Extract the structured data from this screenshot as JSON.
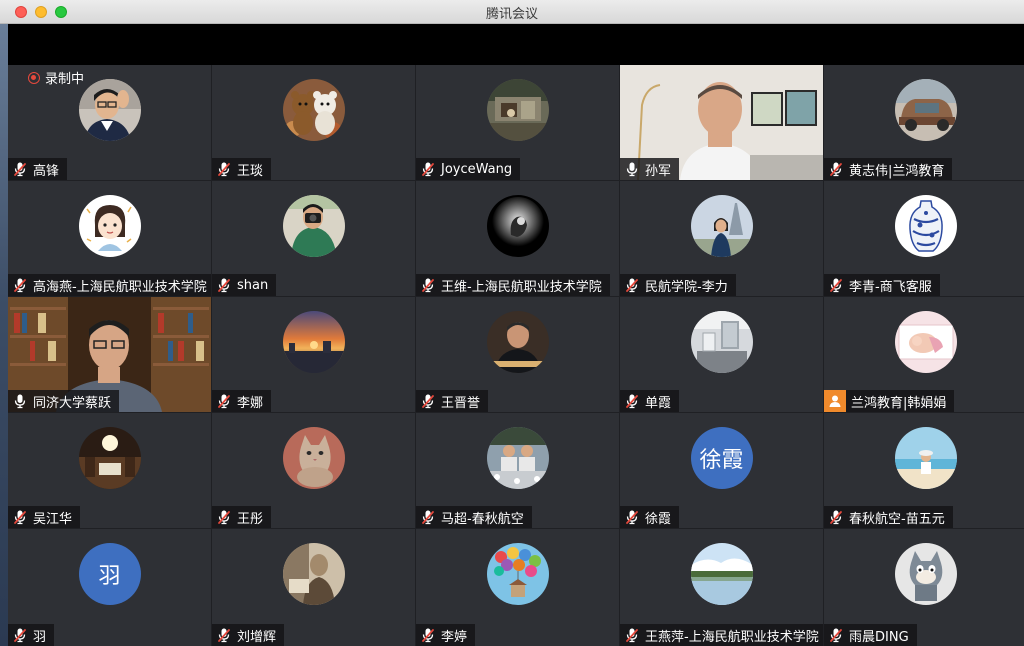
{
  "window": {
    "title": "腾讯会议"
  },
  "recording": {
    "label": "录制中"
  },
  "colors": {
    "speaking_border": "#2bd15b",
    "muted_mic": "#ffffff",
    "muted_slash": "#e5493d",
    "letter_avatar": "#3e6fc0",
    "user_badge": "#f08a2c"
  },
  "participants": [
    {
      "name": "高锋",
      "mic": "muted",
      "display": "photo-avatar",
      "avatar": "man-with-glasses"
    },
    {
      "name": "王琰",
      "mic": "muted",
      "display": "photo-avatar",
      "avatar": "teddy-bears"
    },
    {
      "name": "JoyceWang",
      "mic": "muted",
      "display": "photo-avatar",
      "avatar": "room-scene"
    },
    {
      "name": "孙军",
      "mic": "unmuted",
      "display": "video",
      "speaking": true
    },
    {
      "name": "黄志伟|兰鸿教育",
      "mic": "muted",
      "display": "photo-avatar",
      "avatar": "vintage-car"
    },
    {
      "name": "高海燕-上海民航职业技术学院",
      "mic": "muted",
      "display": "photo-avatar",
      "avatar": "cartoon-girl"
    },
    {
      "name": "shan",
      "mic": "muted",
      "display": "photo-avatar",
      "avatar": "photographer"
    },
    {
      "name": "王维-上海民航职业技术学院",
      "mic": "muted",
      "display": "photo-avatar",
      "avatar": "hand-gesture"
    },
    {
      "name": "民航学院-李力",
      "mic": "muted",
      "display": "photo-avatar",
      "avatar": "eiffel-tower"
    },
    {
      "name": "李青-商飞客服",
      "mic": "muted",
      "display": "photo-avatar",
      "avatar": "blue-white-vase"
    },
    {
      "name": "同济大学蔡跃",
      "mic": "unmuted",
      "display": "video"
    },
    {
      "name": "李娜",
      "mic": "muted",
      "display": "photo-avatar",
      "avatar": "sunset-city"
    },
    {
      "name": "王晋誉",
      "mic": "muted",
      "display": "photo-avatar",
      "avatar": "man-portrait"
    },
    {
      "name": "单霞",
      "mic": "muted",
      "display": "photo-avatar",
      "avatar": "interior"
    },
    {
      "name": "兰鸿教育|韩娟娟",
      "mic": "none",
      "display": "photo-avatar",
      "avatar": "baby"
    },
    {
      "name": "吴江华",
      "mic": "muted",
      "display": "photo-avatar",
      "avatar": "library-hall"
    },
    {
      "name": "王彤",
      "mic": "muted",
      "display": "photo-avatar",
      "avatar": "cat"
    },
    {
      "name": "马超-春秋航空",
      "mic": "muted",
      "display": "photo-avatar",
      "avatar": "group-photo"
    },
    {
      "name": "徐霞",
      "mic": "muted",
      "display": "letter-avatar",
      "avatar_text": "徐霞"
    },
    {
      "name": "春秋航空-苗五元",
      "mic": "muted",
      "display": "photo-avatar",
      "avatar": "beach-child"
    },
    {
      "name": "羽",
      "mic": "muted",
      "display": "letter-avatar",
      "avatar_text": "羽"
    },
    {
      "name": "刘增辉",
      "mic": "muted",
      "display": "photo-avatar",
      "avatar": "sepia-portrait"
    },
    {
      "name": "李婷",
      "mic": "muted",
      "display": "photo-avatar",
      "avatar": "balloons"
    },
    {
      "name": "王燕萍-上海民航职业技术学院",
      "mic": "muted",
      "display": "photo-avatar",
      "avatar": "lake-reflection"
    },
    {
      "name": "雨晨DING",
      "mic": "muted",
      "display": "photo-avatar",
      "avatar": "tom-cat-figure"
    }
  ]
}
